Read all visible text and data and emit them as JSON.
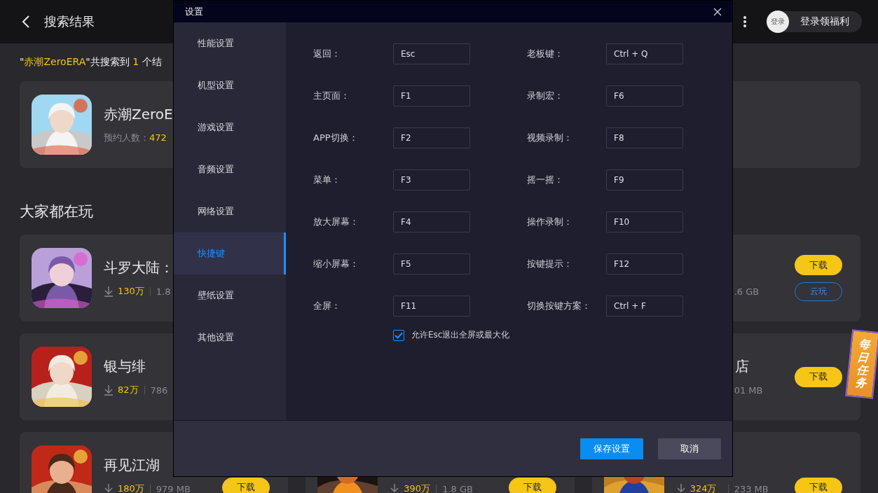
{
  "topbar": {
    "title": "搜索结果",
    "login_avatar": "登录",
    "login_label": "登录领福利"
  },
  "summary": {
    "prefix": "\"",
    "query": "赤潮ZeroERA",
    "middle": "\"共搜索到 ",
    "count": "1",
    "suffix": " 个结"
  },
  "result": {
    "name": "赤潮ZeroE",
    "stat_label": "预约人数：",
    "stat_value": "472"
  },
  "section_title": "大家都在玩",
  "rows": [
    {
      "left": {
        "name": "斗罗大陆：",
        "downloads": "130万",
        "size": "1.8"
      },
      "right": {
        "size": ".6 GB",
        "buttons": [
          {
            "label": "下载",
            "kind": "download"
          },
          {
            "label": "云玩",
            "kind": "cloud"
          }
        ]
      }
    },
    {
      "left": {
        "name": "银与绯",
        "downloads": "82万",
        "size": "786"
      },
      "right": {
        "name": "店",
        "size": "01 MB",
        "buttons": [
          {
            "label": "下载",
            "kind": "download"
          }
        ]
      }
    },
    {
      "left": {
        "name": "再见江湖",
        "downloads": "180万",
        "size": "979 MB",
        "buttons": [
          {
            "label": "下载",
            "kind": "download"
          }
        ]
      },
      "middle": {
        "downloads": "390万",
        "size": "1.8 GB",
        "buttons": [
          {
            "label": "下载",
            "kind": "download"
          }
        ]
      },
      "right": {
        "downloads": "324万",
        "size": "233 MB",
        "buttons": [
          {
            "label": "下载",
            "kind": "download"
          }
        ]
      }
    }
  ],
  "daily_badge": "每日任务",
  "dialog": {
    "title": "设置",
    "sidebar": [
      {
        "label": "性能设置",
        "selected": false
      },
      {
        "label": "机型设置",
        "selected": false
      },
      {
        "label": "游戏设置",
        "selected": false
      },
      {
        "label": "音频设置",
        "selected": false
      },
      {
        "label": "网络设置",
        "selected": false
      },
      {
        "label": "快捷键",
        "selected": true
      },
      {
        "label": "壁纸设置",
        "selected": false
      },
      {
        "label": "其他设置",
        "selected": false
      }
    ],
    "shortcuts": [
      {
        "label": "返回：",
        "value": "Esc"
      },
      {
        "label": "老板键：",
        "value": "Ctrl + Q"
      },
      {
        "label": "主页面：",
        "value": "F1"
      },
      {
        "label": "录制宏：",
        "value": "F6"
      },
      {
        "label": "APP切换：",
        "value": "F2"
      },
      {
        "label": "视频录制：",
        "value": "F8"
      },
      {
        "label": "菜单：",
        "value": "F3"
      },
      {
        "label": "摇一摇：",
        "value": "F9"
      },
      {
        "label": "放大屏幕：",
        "value": "F4"
      },
      {
        "label": "操作录制：",
        "value": "F10"
      },
      {
        "label": "缩小屏幕：",
        "value": "F5"
      },
      {
        "label": "按键提示：",
        "value": "F12"
      },
      {
        "label": "全屏：",
        "value": "F11"
      },
      {
        "label": "切换按键方案：",
        "value": "Ctrl + F"
      }
    ],
    "checkbox": {
      "label": "允许Esc退出全屏或最大化",
      "checked": true
    },
    "buttons": [
      {
        "label": "保存设置",
        "kind": "primary"
      },
      {
        "label": "取消",
        "kind": "secondary"
      }
    ]
  }
}
